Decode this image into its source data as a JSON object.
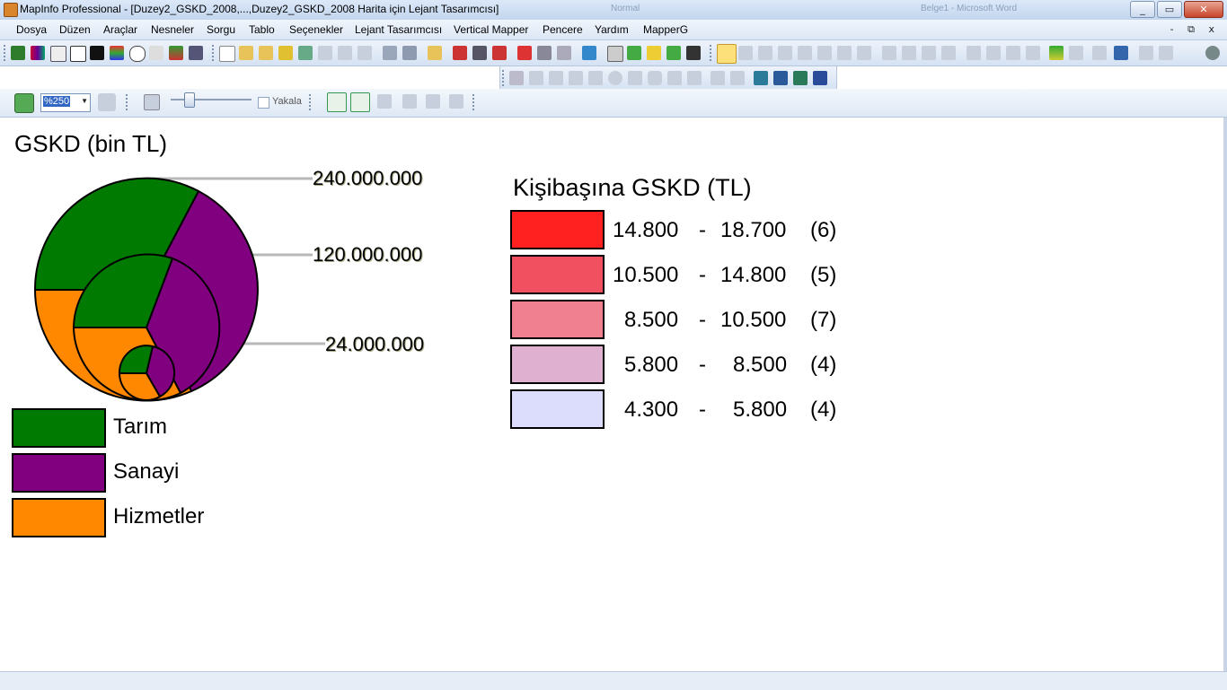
{
  "window": {
    "title": "MapInfo Professional - [Duzey2_GSKD_2008,...,Duzey2_GSKD_2008 Harita için Lejant Tasarımcısı]",
    "bg_tab_1": "Normal",
    "bg_tab_2": "Belge1 - Microsoft Word",
    "minimize": "_",
    "restore": "▭",
    "close": "✕"
  },
  "menu": {
    "items": [
      "Dosya",
      "Düzen",
      "Araçlar",
      "Nesneler",
      "Sorgu",
      "Tablo",
      "Seçenekler",
      "Lejant Tasarımcısı",
      "Vertical Mapper",
      "Pencere",
      "Yardım",
      "MapperG"
    ],
    "mdi_controls": "-  ⧉  x"
  },
  "toolbar3": {
    "zoom_value": "%250",
    "snap_label": "Yakala"
  },
  "map": {
    "title": "GSKD (bin TL)",
    "size_labels": [
      "240.000.000",
      "120.000.000",
      "24.000.000"
    ],
    "sector_legend": [
      {
        "label": "Tarım",
        "color": "#007a00"
      },
      {
        "label": "Sanayi",
        "color": "#800080"
      },
      {
        "label": "Hizmetler",
        "color": "#ff8800"
      }
    ],
    "range_legend_title": "Kişibaşına GSKD (TL)",
    "ranges": [
      {
        "low": "14.800",
        "high": "18.700",
        "count": "(6)",
        "color": "#ff2020"
      },
      {
        "low": "10.500",
        "high": "14.800",
        "count": "(5)",
        "color": "#f05060"
      },
      {
        "low": "8.500",
        "high": "10.500",
        "count": "(7)",
        "color": "#f08090"
      },
      {
        "low": "5.800",
        "high": "8.500",
        "count": "(4)",
        "color": "#e0b0d0"
      },
      {
        "low": "4.300",
        "high": "5.800",
        "count": "(4)",
        "color": "#dcdcfc"
      }
    ]
  }
}
